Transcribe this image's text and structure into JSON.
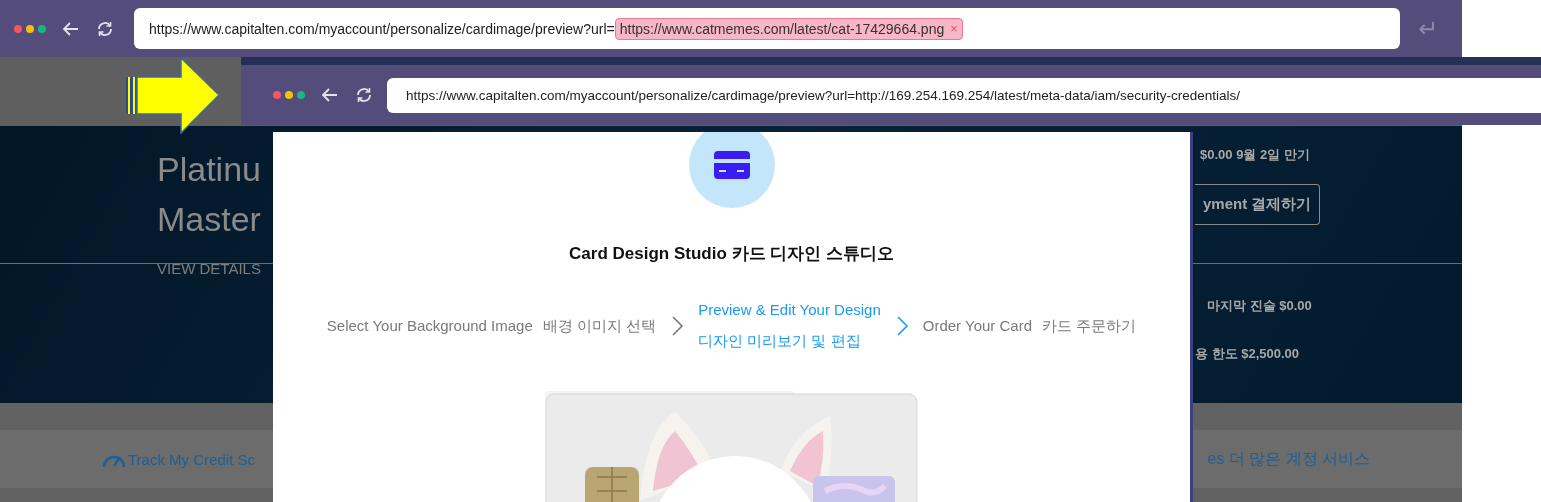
{
  "back_window": {
    "url": "https://www.capitalten.com/myaccount/personalize/cardimage/preview?url=",
    "url_param": "https://www.catmemes.com/latest/cat-17429664.png",
    "url_param_remove": "×",
    "enter_key": "↵"
  },
  "page": {
    "hero": {
      "title_lines": [
        "Platinu",
        "Master"
      ],
      "view_details": "VIEW DETAILS",
      "due": "$0.00 9월 2일 만기",
      "pay_button": "yment  결제하기",
      "last_statement": "마지막 진술 $0.00",
      "credit_limit": "용 한도 $2,500.00"
    },
    "links": [
      "Track My Credit Sc",
      "es  더 많은 계정 서비스"
    ]
  },
  "front_window": {
    "url": "https://www.capitalten.com/myaccount/personalize/cardimage/preview?url=http://169.254.169.254/latest/meta-data/iam/security-credentials/"
  },
  "modal": {
    "title": "Card Design Studio  카드 디자인 스튜디오",
    "steps": [
      {
        "label": "Select Your Background Image",
        "label_ko": "배경 이미지 선택",
        "selected": false
      },
      {
        "label": "Preview & Edit Your Design",
        "label_ko": "디자인 미리보기 및 편집",
        "selected": true
      },
      {
        "label": "Order Your Card",
        "label_ko": "카드 주문하기",
        "selected": false
      }
    ]
  }
}
